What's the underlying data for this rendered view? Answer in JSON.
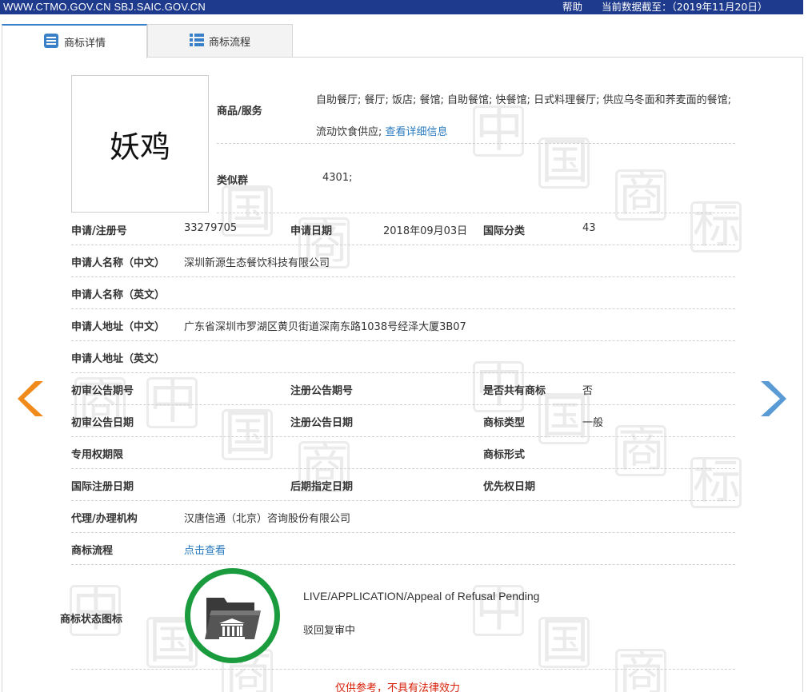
{
  "topbar": {
    "sites": "WWW.CTMO.GOV.CN SBJ.SAIC.GOV.CN",
    "help": "帮助",
    "data_as_of": "当前数据截至：（2019年11月20日）"
  },
  "tabs": [
    {
      "label": "商标详情",
      "icon": "list-icon",
      "active": true
    },
    {
      "label": "商标流程",
      "icon": "grid-icon",
      "active": false
    }
  ],
  "trademark": {
    "name": "妖鸡",
    "goods_label": "商品/服务",
    "goods_text": "自助餐厅; 餐厅; 饭店; 餐馆; 自助餐馆; 快餐馆; 日式料理餐厅; 供应乌冬面和荞麦面的餐馆; 流动饮食供应;",
    "goods_link": "查看详细信息",
    "similar_group_label": "类似群",
    "similar_group": "4301;"
  },
  "fields": {
    "reg_no_label": "申请/注册号",
    "reg_no": "33279705",
    "apply_date_label": "申请日期",
    "apply_date": "2018年09月03日",
    "intl_class_label": "国际分类",
    "intl_class": "43",
    "applicant_cn_label": "申请人名称（中文）",
    "applicant_cn": "深圳新源生态餐饮科技有限公司",
    "applicant_en_label": "申请人名称（英文）",
    "applicant_en": "",
    "address_cn_label": "申请人地址（中文）",
    "address_cn": "广东省深圳市罗湖区黄贝街道深南东路1038号经泽大厦3B07",
    "address_en_label": "申请人地址（英文）",
    "address_en": "",
    "prelim_no_label": "初审公告期号",
    "prelim_no": "",
    "reg_pub_no_label": "注册公告期号",
    "reg_pub_no": "",
    "shared_label": "是否共有商标",
    "shared": "否",
    "prelim_date_label": "初审公告日期",
    "prelim_date": "",
    "reg_pub_date_label": "注册公告日期",
    "reg_pub_date": "",
    "tm_type_label": "商标类型",
    "tm_type": "一般",
    "exclusive_label": "专用权期限",
    "exclusive": "",
    "tm_form_label": "商标形式",
    "tm_form": "",
    "intl_reg_date_label": "国际注册日期",
    "intl_reg_date": "",
    "later_date_label": "后期指定日期",
    "later_date": "",
    "priority_label": "优先权日期",
    "priority": "",
    "agent_label": "代理/办理机构",
    "agent": "汉唐信通（北京）咨询股份有限公司",
    "flow_label": "商标流程",
    "flow_link": "点击查看"
  },
  "status": {
    "label": "商标状态图标",
    "icon": "folder-courthouse-icon",
    "en": "LIVE/APPLICATION/Appeal of Refusal Pending",
    "cn": "驳回复审中"
  },
  "nav": {
    "prev_icon": "chevron-left-icon",
    "next_icon": "chevron-right-icon"
  },
  "watermark_chars": [
    "中",
    "国",
    "商",
    "标"
  ],
  "disclaimer": "仅供参考，不具有法律效力",
  "colors": {
    "topbar_bg": "#1e3a8c",
    "link": "#2a7bc0",
    "status_ring": "#1a9c3e",
    "prev_arrow": "#f08a1a",
    "next_arrow": "#5b9bd5",
    "disclaimer": "#d81e06"
  }
}
